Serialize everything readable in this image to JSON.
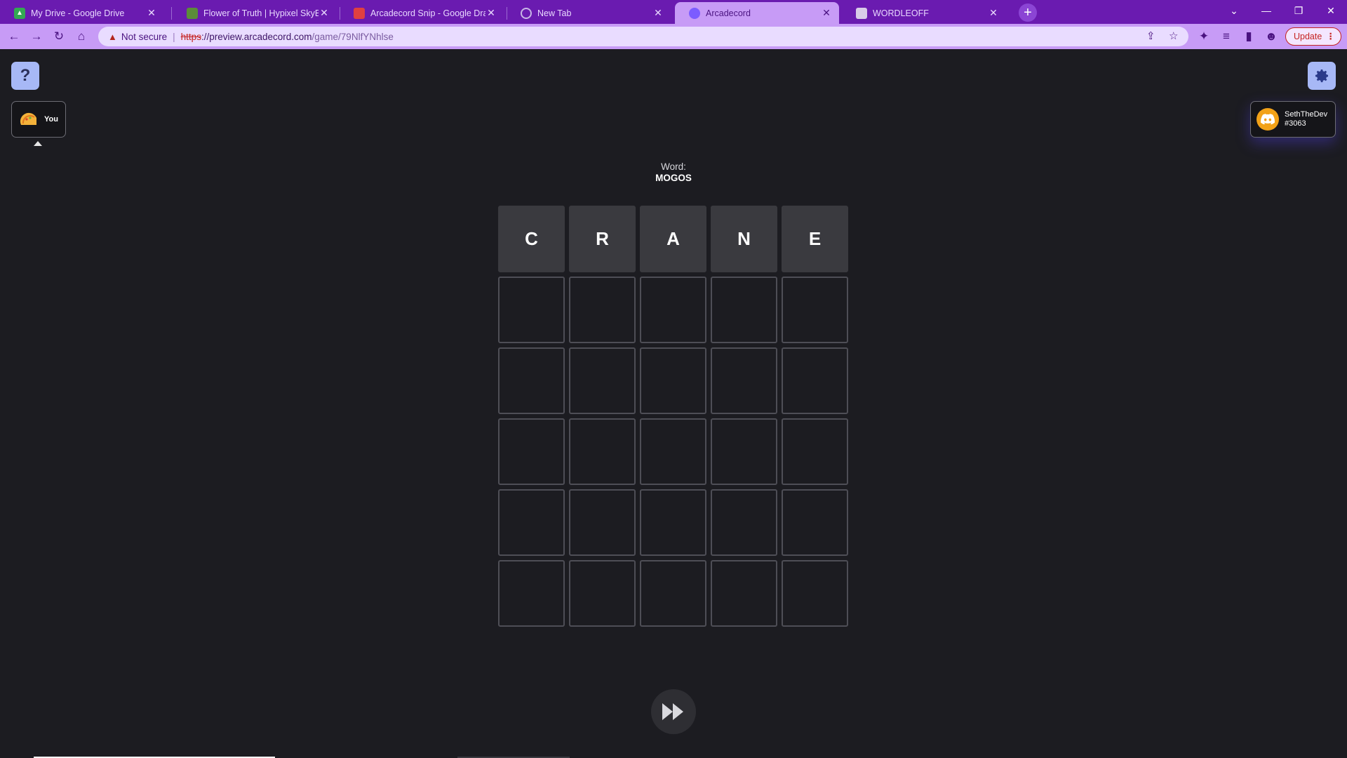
{
  "browser": {
    "tabs": [
      {
        "title": "My Drive - Google Drive",
        "icon": "google-drive-icon",
        "color": "#34a853"
      },
      {
        "title": "Flower of Truth | Hypixel SkyBlock",
        "icon": "skyblock-icon",
        "color": "#5b8c3a"
      },
      {
        "title": "Arcadecord Snip - Google Drawings",
        "icon": "arcadecord-snip-icon",
        "color": "#e04040"
      },
      {
        "title": "New Tab",
        "icon": "chrome-icon",
        "color": "#c8b6e6"
      },
      {
        "title": "Arcadecord",
        "icon": "arcadecord-icon",
        "color": "#7c5cff"
      },
      {
        "title": "WORDLEOFF",
        "icon": "page-icon",
        "color": "#d8cbe8"
      }
    ],
    "active_tab": 4,
    "omnibox": {
      "security": "Not secure",
      "protocol": "https",
      "host": "://preview.arcadecord.com",
      "path": "/game/79NlfYNhlse"
    },
    "update_label": "Update"
  },
  "game": {
    "word_label": "Word:",
    "word_value": "MOGOS",
    "you_label": "You",
    "user": {
      "name": "SethTheDev",
      "tag": "#3063"
    },
    "guess": [
      "C",
      "R",
      "A",
      "N",
      "E"
    ],
    "rows": 6,
    "cols": 5
  },
  "colors": {
    "background": "#1c1c21",
    "accent": "#a7b8f6",
    "tab_strip": "#6a1bb0",
    "toolbar": "#c79bf6",
    "filled_tile": "#3a3a3f",
    "empty_tile_border": "#4e4e56"
  }
}
